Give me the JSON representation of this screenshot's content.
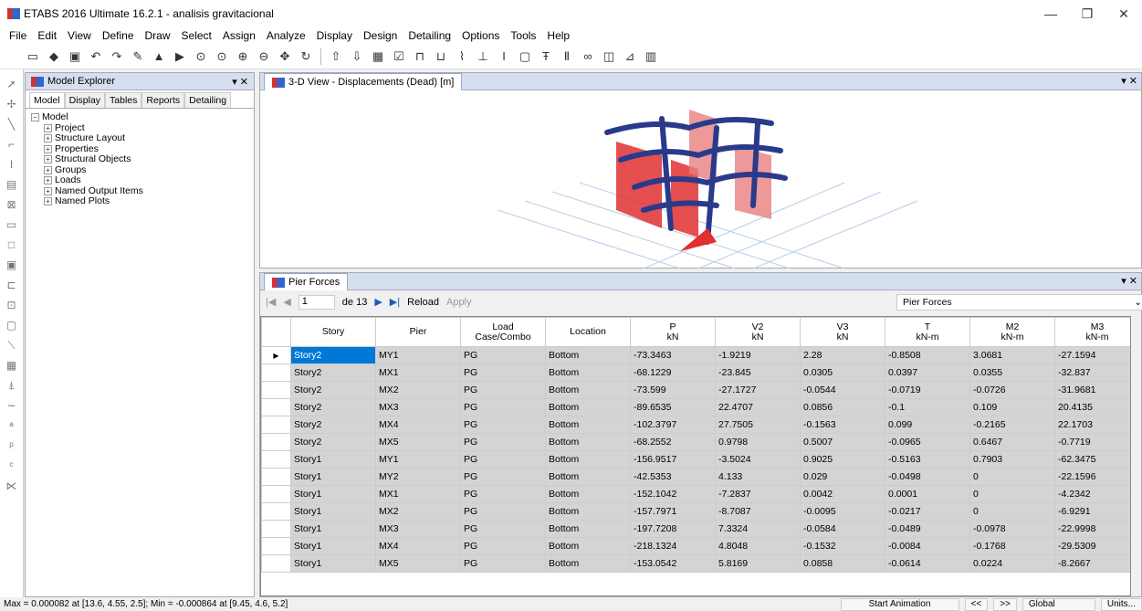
{
  "window": {
    "title": "ETABS 2016 Ultimate 16.2.1 - analisis gravitacional"
  },
  "menu": [
    "File",
    "Edit",
    "View",
    "Define",
    "Draw",
    "Select",
    "Assign",
    "Analyze",
    "Display",
    "Design",
    "Detailing",
    "Options",
    "Tools",
    "Help"
  ],
  "explorer": {
    "title": "Model Explorer",
    "tabs": [
      "Model",
      "Display",
      "Tables",
      "Reports",
      "Detailing"
    ],
    "root": "Model",
    "items": [
      "Project",
      "Structure Layout",
      "Properties",
      "Structural Objects",
      "Groups",
      "Loads",
      "Named Output Items",
      "Named Plots"
    ]
  },
  "view3d": {
    "tab": "3-D View  - Displacements (Dead)  [m]"
  },
  "pier": {
    "tab": "Pier Forces",
    "page": "1",
    "of": "de 13",
    "reload": "Reload",
    "apply": "Apply",
    "selector": "Pier Forces",
    "headers": [
      {
        "l1": "Story",
        "l2": ""
      },
      {
        "l1": "Pier",
        "l2": ""
      },
      {
        "l1": "Load",
        "l2": "Case/Combo"
      },
      {
        "l1": "Location",
        "l2": ""
      },
      {
        "l1": "P",
        "l2": "kN"
      },
      {
        "l1": "V2",
        "l2": "kN"
      },
      {
        "l1": "V3",
        "l2": "kN"
      },
      {
        "l1": "T",
        "l2": "kN-m"
      },
      {
        "l1": "M2",
        "l2": "kN-m"
      },
      {
        "l1": "M3",
        "l2": "kN-m"
      }
    ],
    "rows": [
      [
        "Story2",
        "MY1",
        "PG",
        "Bottom",
        "-73.3463",
        "-1.9219",
        "2.28",
        "-0.8508",
        "3.0681",
        "-27.1594"
      ],
      [
        "Story2",
        "MX1",
        "PG",
        "Bottom",
        "-68.1229",
        "-23.845",
        "0.0305",
        "0.0397",
        "0.0355",
        "-32.837"
      ],
      [
        "Story2",
        "MX2",
        "PG",
        "Bottom",
        "-73.599",
        "-27.1727",
        "-0.0544",
        "-0.0719",
        "-0.0726",
        "-31.9681"
      ],
      [
        "Story2",
        "MX3",
        "PG",
        "Bottom",
        "-89.6535",
        "22.4707",
        "0.0856",
        "-0.1",
        "0.109",
        "20.4135"
      ],
      [
        "Story2",
        "MX4",
        "PG",
        "Bottom",
        "-102.3797",
        "27.7505",
        "-0.1563",
        "0.099",
        "-0.2165",
        "22.1703"
      ],
      [
        "Story2",
        "MX5",
        "PG",
        "Bottom",
        "-68.2552",
        "0.9798",
        "0.5007",
        "-0.0965",
        "0.6467",
        "-0.7719"
      ],
      [
        "Story1",
        "MY1",
        "PG",
        "Bottom",
        "-156.9517",
        "-3.5024",
        "0.9025",
        "-0.5163",
        "0.7903",
        "-62.3475"
      ],
      [
        "Story1",
        "MY2",
        "PG",
        "Bottom",
        "-42.5353",
        "4.133",
        "0.029",
        "-0.0498",
        "0",
        "-22.1596"
      ],
      [
        "Story1",
        "MX1",
        "PG",
        "Bottom",
        "-152.1042",
        "-7.2837",
        "0.0042",
        "0.0001",
        "0",
        "-4.2342"
      ],
      [
        "Story1",
        "MX2",
        "PG",
        "Bottom",
        "-157.7971",
        "-8.7087",
        "-0.0095",
        "-0.0217",
        "0",
        "-6.9291"
      ],
      [
        "Story1",
        "MX3",
        "PG",
        "Bottom",
        "-197.7208",
        "7.3324",
        "-0.0584",
        "-0.0489",
        "-0.0978",
        "-22.9998"
      ],
      [
        "Story1",
        "MX4",
        "PG",
        "Bottom",
        "-218.1324",
        "4.8048",
        "-0.1532",
        "-0.0084",
        "-0.1768",
        "-29.5309"
      ],
      [
        "Story1",
        "MX5",
        "PG",
        "Bottom",
        "-153.0542",
        "5.8169",
        "0.0858",
        "-0.0614",
        "0.0224",
        "-8.2667"
      ]
    ]
  },
  "status": {
    "text": "Max = 0.000082 at [13.6, 4.55, 2.5];  Min = -0.000864 at [9.45, 4.6, 5.2]",
    "animation": "Start Animation",
    "prev": "<<",
    "next": ">>",
    "coord": "Global",
    "units": "Units..."
  }
}
